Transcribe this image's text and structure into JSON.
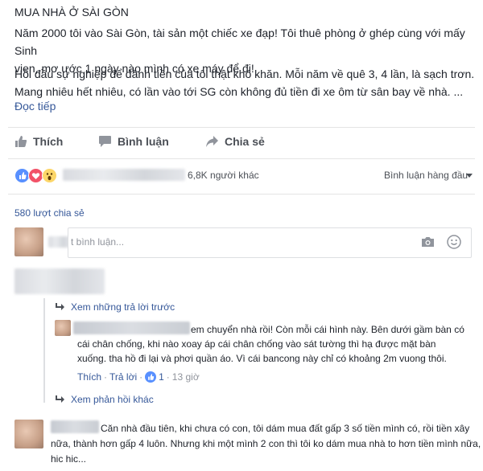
{
  "post": {
    "title": "MUA NHÀ Ở SÀI GÒN",
    "para1_line1": "Năm 2000 tôi vào Sài Gòn, tài sản một chiếc xe đạp! Tôi thuê phòng ở ghép cùng với mấy Sinh",
    "para1_line2": "vien, mơ ước 1 ngày nào mình có xe máy để đi!",
    "para2_line1": "Hồi đầu sự nghiệp để dành tiền của tôi thật khó khăn. Mỗi năm về quê 3, 4 lần, là sạch trơn.",
    "para2_line2": "Mang nhiêu hết nhiêu, có lần vào tới SG còn không đủ tiền đi xe ôm từ sân bay về nhà. ...",
    "read_more": "Đọc tiếp"
  },
  "actions": {
    "like": "Thích",
    "comment": "Bình luận",
    "share": "Chia sẻ"
  },
  "reactions": {
    "others": "6,8K người khác",
    "sort": "Bình luận hàng đầu",
    "shares": "580 lượt chia sẻ"
  },
  "comment_box": {
    "placeholder": "t bình luận..."
  },
  "thread": {
    "view_previous": "Xem những trả lời trước",
    "reply_line1": "em chuyển nhà rồi! Còn mỗi cái hình này. Bên dưới gầm bàn có",
    "reply_line2": "cái chân chống, khi nào xoay áp cái chân chống vào sát tường thì hạ được mặt bàn",
    "reply_line3": "xuống. tha hồ đi lại và phơi quần áo. Vì cái bancong này chỉ có khoảng 2m vuong thôi.",
    "reply_like": "Thích",
    "reply_reply": "Trả lời",
    "reply_count": "1",
    "reply_time": "13 giờ",
    "more_replies": "Xem phản hồi khác"
  },
  "comment2": {
    "line1": "Căn nhà đầu tiên, khi chưa có con, tôi dám mua đất gấp 3 số tiền mình có, rồi tiền xây",
    "line2": "nữa, thành hơn gấp 4 luôn. Nhưng khi một mình 2 con thì tôi ko dám mua nhà to hơn tiền mình nữa,",
    "line3": "hic hic..."
  },
  "colors": {
    "link": "#365899",
    "text": "#1d2129",
    "muted": "#4b4f56",
    "like_blue": "#5890ff",
    "love_red": "#f25268",
    "haha_yellow": "#fcd669"
  }
}
